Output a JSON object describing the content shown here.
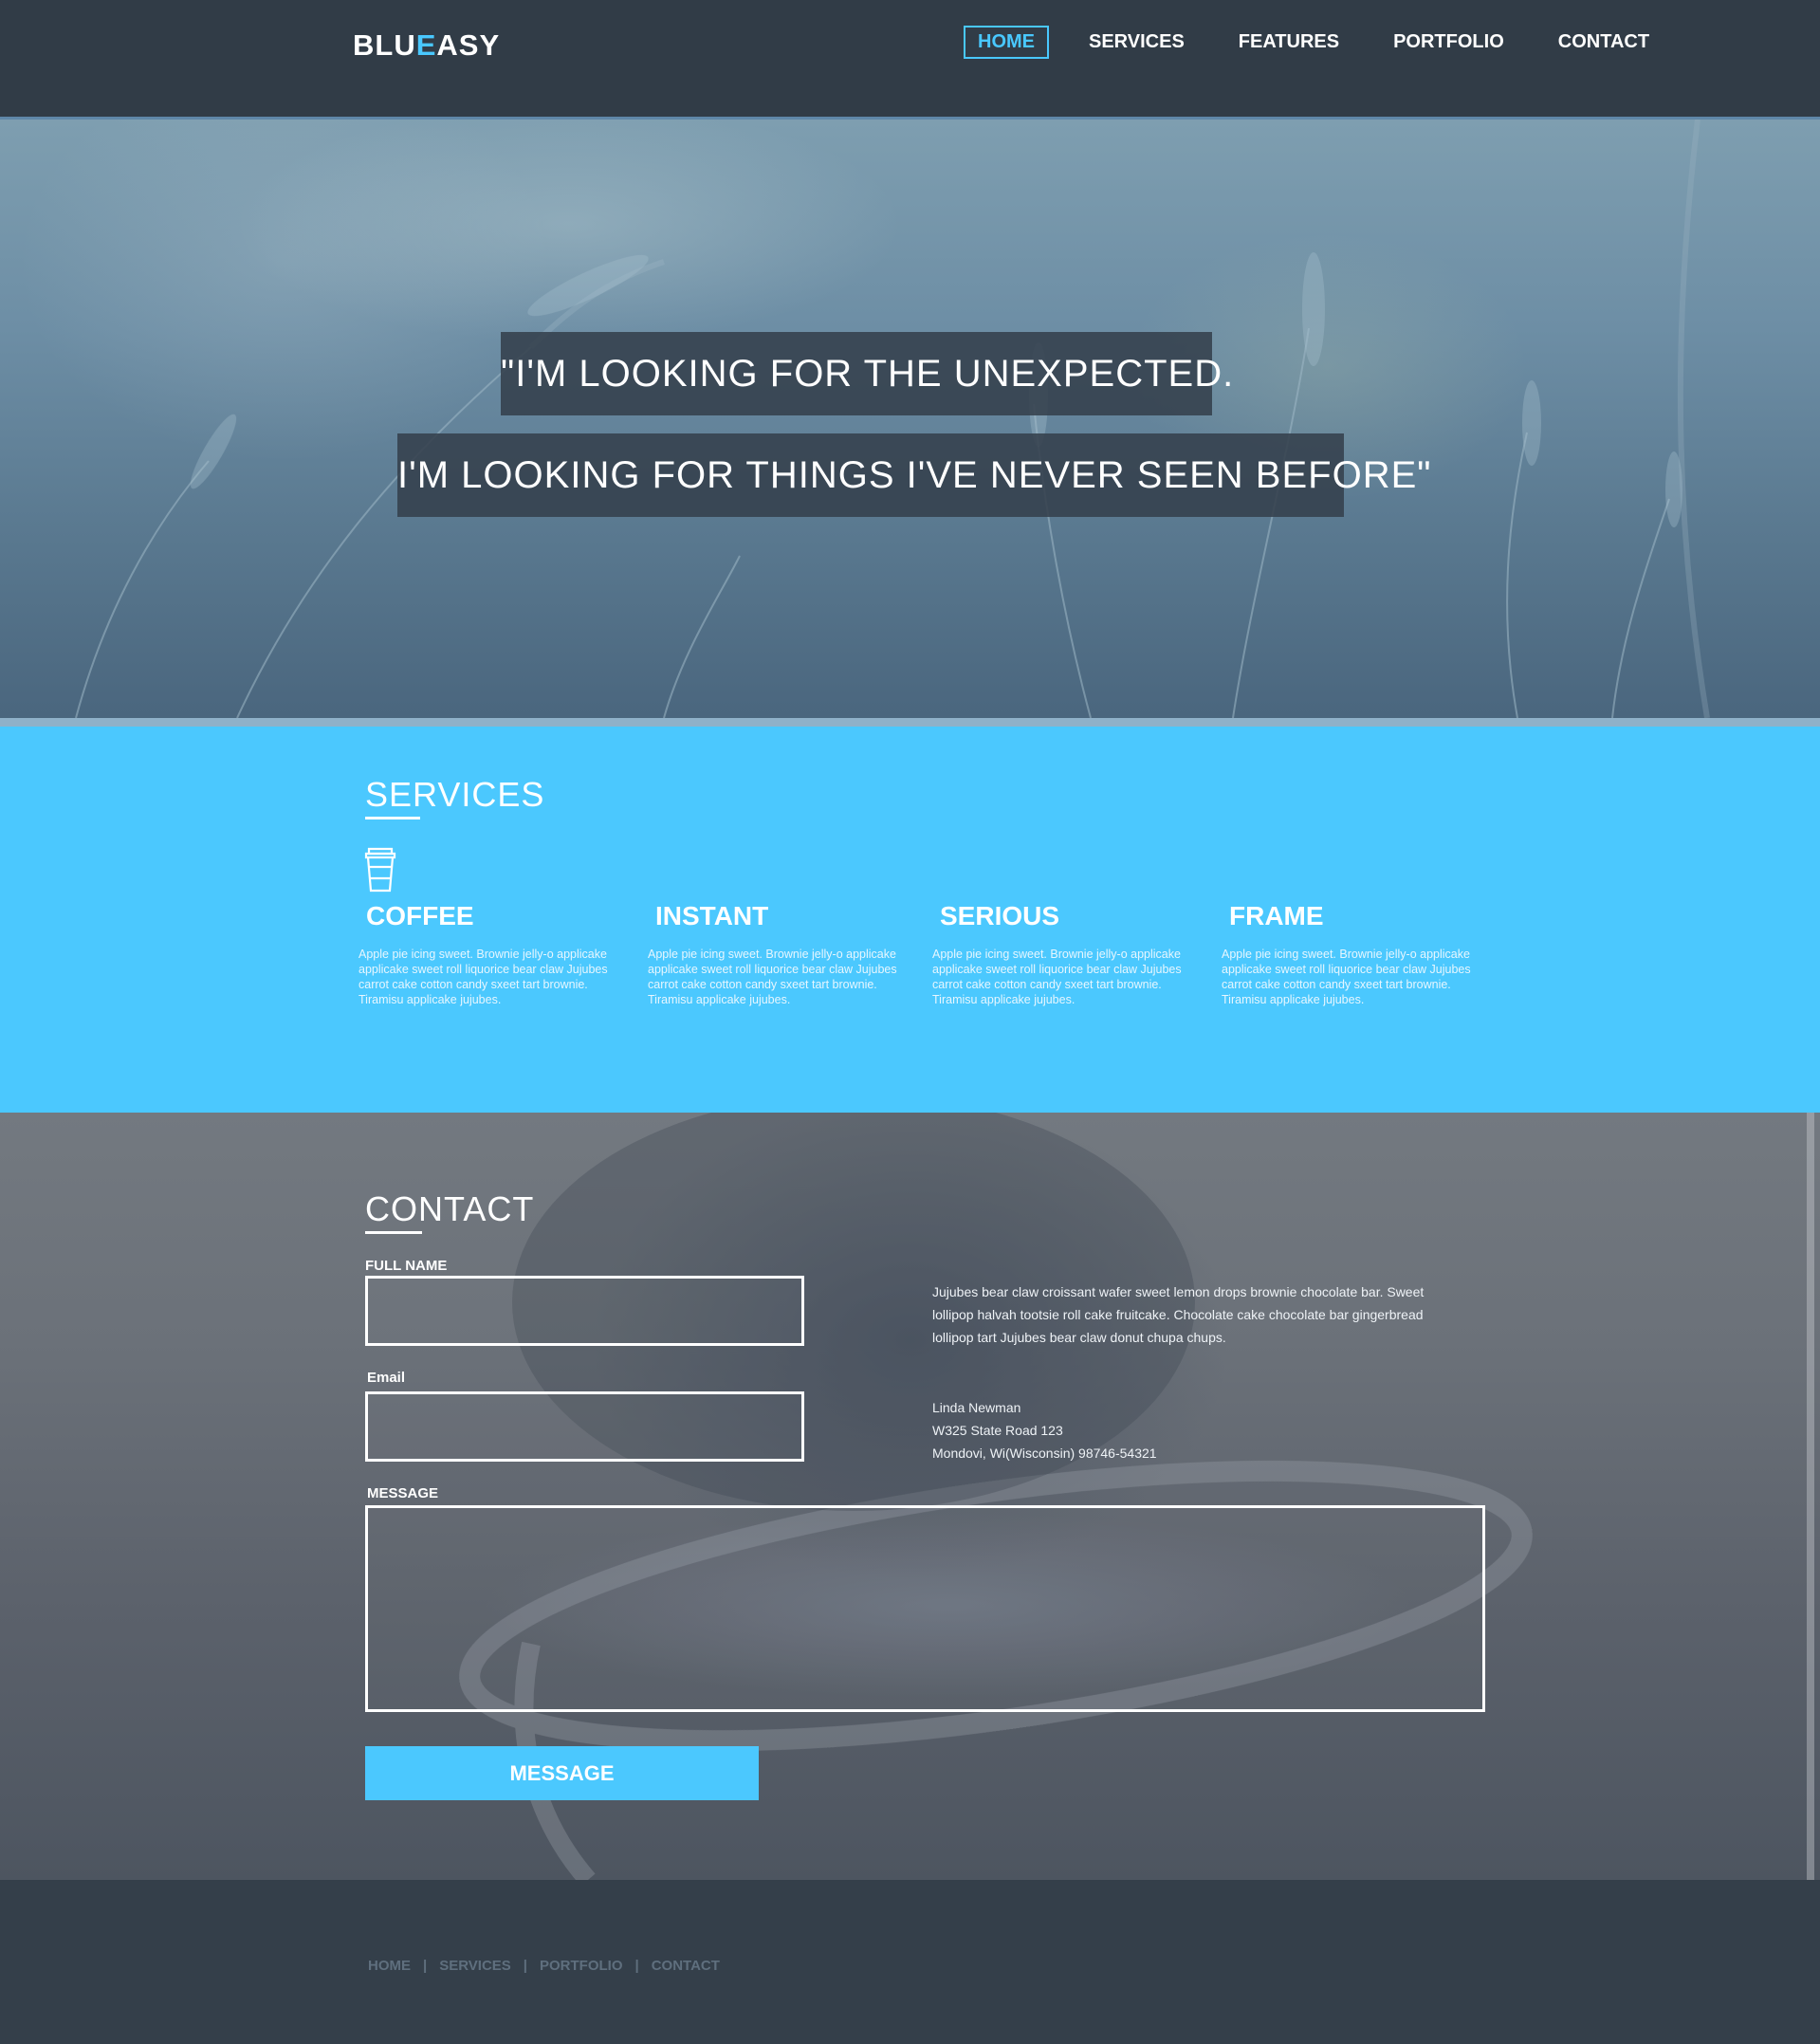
{
  "header": {
    "logo": {
      "part1": "BLU",
      "part2": "E",
      "part3": "ASY"
    },
    "nav": [
      "HOME",
      "SERVICES",
      "FEATURES",
      "PORTFOLIO",
      "CONTACT"
    ],
    "active_nav": "HOME"
  },
  "hero": {
    "quote_line1": "\"I'M LOOKING FOR THE UNEXPECTED.",
    "quote_line2": "I'M LOOKING FOR THINGS I'VE NEVER SEEN BEFORE\""
  },
  "services": {
    "title": "SERVICES",
    "icon": "coffee-cup-icon",
    "items": [
      {
        "title": "COFFEE",
        "text": "Apple pie icing sweet. Brownie jelly-o applicake applicake sweet roll liquorice bear claw Jujubes carrot cake cotton candy sxeet tart brownie. Tiramisu applicake jujubes."
      },
      {
        "title": "INSTANT",
        "text": "Apple pie icing sweet. Brownie jelly-o applicake applicake sweet roll liquorice bear claw Jujubes carrot cake cotton candy sxeet tart brownie. Tiramisu applicake jujubes."
      },
      {
        "title": "SERIOUS",
        "text": "Apple pie icing sweet. Brownie jelly-o applicake applicake sweet roll liquorice bear claw Jujubes carrot cake cotton candy sxeet tart brownie. Tiramisu applicake jujubes."
      },
      {
        "title": "FRAME",
        "text": "Apple pie icing sweet. Brownie jelly-o applicake applicake sweet roll liquorice bear claw Jujubes carrot cake cotton candy sxeet tart brownie. Tiramisu applicake jujubes."
      }
    ]
  },
  "contact": {
    "title": "CONTACT",
    "full_name_label": "FULL NAME",
    "full_name_value": "",
    "email_label": "Email",
    "email_value": "",
    "message_label": "MESSAGE",
    "message_value": "",
    "description": "Jujubes bear claw croissant wafer sweet lemon drops brownie chocolate bar. Sweet lollipop halvah tootsie roll cake fruitcake. Chocolate cake chocolate bar gingerbread lollipop tart Jujubes bear claw donut chupa chups.",
    "address_name": "Linda Newman",
    "address_street": "W325 State Road 123",
    "address_city": "Mondovi, Wi(Wisconsin) 98746-54321",
    "button_label": "MESSAGE"
  },
  "footer": {
    "links": [
      "HOME",
      "SERVICES",
      "PORTFOLIO",
      "CONTACT"
    ],
    "separator": "|"
  },
  "colors": {
    "accent": "#4bc8fe",
    "header_bg": "#313c47",
    "footer_bg": "#343f4a",
    "quote_bg": "#34404c"
  }
}
